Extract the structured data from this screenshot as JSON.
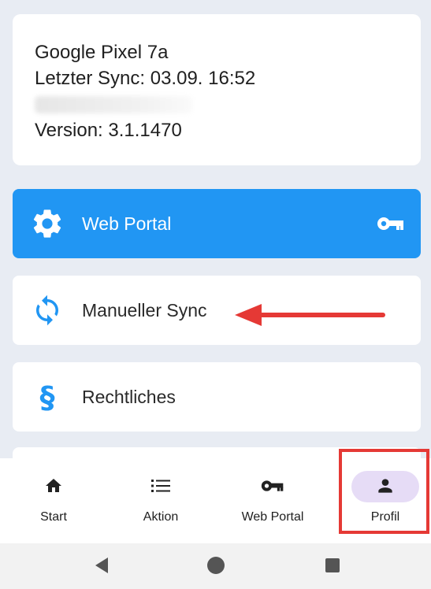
{
  "device_info": {
    "device_name": "Google Pixel 7a",
    "last_sync": "Letzter Sync: 03.09. 16:52",
    "version": "Version: 3.1.1470"
  },
  "menu": {
    "web_portal_label": "Web Portal",
    "manual_sync_label": "Manueller Sync",
    "legal_label": "Rechtliches"
  },
  "bottom_nav": {
    "start": "Start",
    "aktion": "Aktion",
    "web_portal": "Web Portal",
    "profil": "Profil",
    "active": "Profil"
  },
  "icons": {
    "web_portal_menu": "gear-icon",
    "web_portal_trailing": "key-icon",
    "manual_sync": "sync-icon",
    "legal": "section-sign-icon",
    "nav_start": "home-icon",
    "nav_aktion": "list-icon",
    "nav_web_portal": "key-icon",
    "nav_profil": "person-icon"
  },
  "colors": {
    "accent": "#2196f3",
    "background": "#e8ecf3",
    "active_pill": "#e6dcf6",
    "annotation": "#e53935"
  }
}
